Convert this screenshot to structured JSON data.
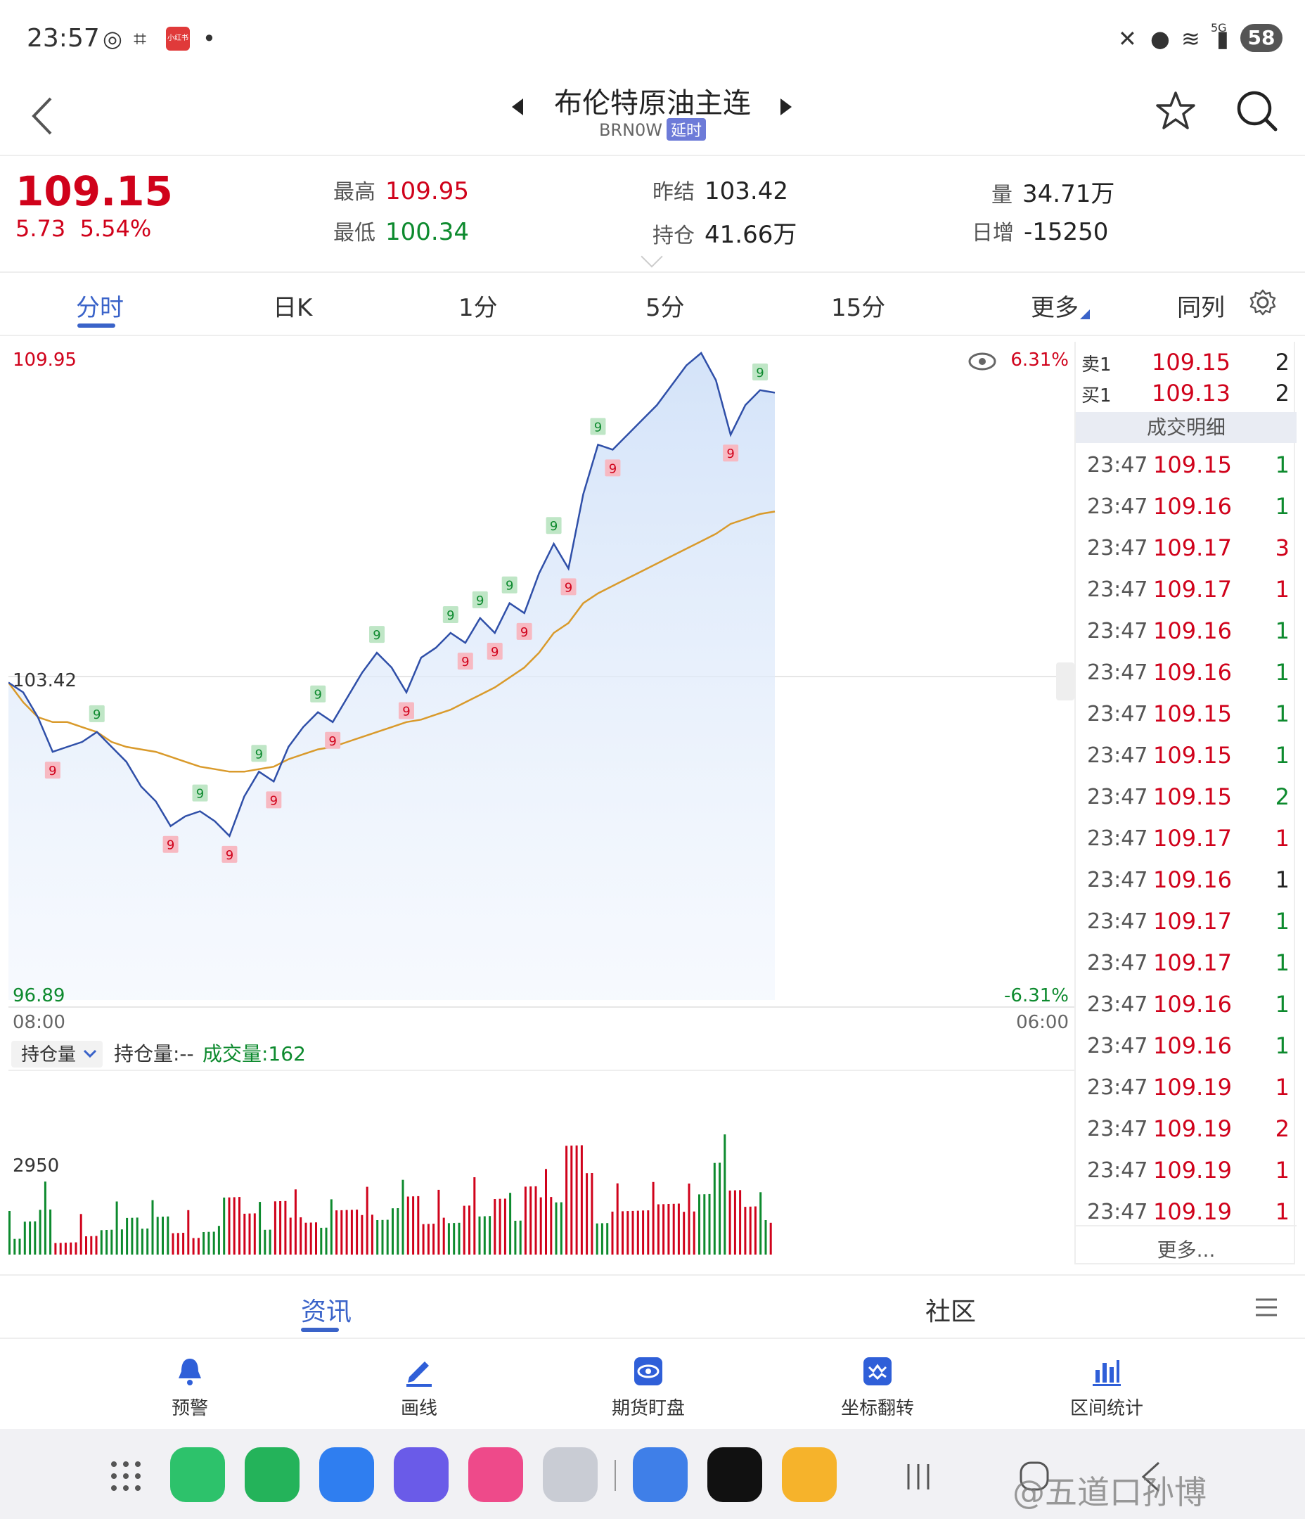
{
  "status_bar": {
    "time": "23:57",
    "badge_text": "小红书",
    "battery": "58",
    "network": "5G"
  },
  "header": {
    "title": "布伦特原油主连",
    "code": "BRN0W",
    "delay_badge": "延时"
  },
  "quote": {
    "last_price": "109.15",
    "change": "5.73",
    "change_pct": "5.54%",
    "high_label": "最高",
    "high": "109.95",
    "low_label": "最低",
    "low": "100.34",
    "prev_settle_label": "昨结",
    "prev_settle": "103.42",
    "open_interest_label": "持仓",
    "open_interest": "41.66万",
    "volume_label": "量",
    "volume": "34.71万",
    "daily_change_label": "日增",
    "daily_change": "-15250"
  },
  "tabs": [
    "分时",
    "日K",
    "1分",
    "5分",
    "15分",
    "更多",
    "同列"
  ],
  "chart": {
    "y_top": "109.95",
    "y_mid": "103.42",
    "y_bottom": "96.89",
    "pct_top": "6.31%",
    "pct_bottom": "-6.31%",
    "x_start": "08:00",
    "x_end": "06:00",
    "indicator_select": "持仓量",
    "oi_text": "持仓量:--",
    "vol_text": "成交量:162",
    "vol_axis_label": "2950"
  },
  "chart_data": {
    "type": "line",
    "ylim": [
      96.89,
      109.95
    ],
    "reference": 103.42,
    "signal_marker": "9",
    "series": [
      {
        "values": [
          103.3,
          103.1,
          102.6,
          101.9,
          102.0,
          102.1,
          102.3,
          102.0,
          101.7,
          101.2,
          100.9,
          100.4,
          100.6,
          100.7,
          100.5,
          100.2,
          101.0,
          101.5,
          101.3,
          102.0,
          102.4,
          102.7,
          102.5,
          103.0,
          103.5,
          103.9,
          103.6,
          103.1,
          103.8,
          104.0,
          104.3,
          104.1,
          104.6,
          104.3,
          104.9,
          104.7,
          105.5,
          106.1,
          105.6,
          107.1,
          108.1,
          108.0,
          108.3,
          108.6,
          108.9,
          109.3,
          109.7,
          109.95,
          109.4,
          108.3,
          108.9,
          109.2,
          109.15
        ]
      },
      {
        "values": [
          103.3,
          102.9,
          102.6,
          102.5,
          102.5,
          102.4,
          102.3,
          102.1,
          102.0,
          101.95,
          101.9,
          101.8,
          101.7,
          101.6,
          101.55,
          101.5,
          101.5,
          101.55,
          101.6,
          101.75,
          101.85,
          101.95,
          102.0,
          102.1,
          102.2,
          102.3,
          102.4,
          102.5,
          102.55,
          102.65,
          102.75,
          102.9,
          103.05,
          103.2,
          103.4,
          103.6,
          103.9,
          104.3,
          104.5,
          104.9,
          105.1,
          105.25,
          105.4,
          105.55,
          105.7,
          105.85,
          106.0,
          106.15,
          106.3,
          106.5,
          106.6,
          106.7,
          106.75
        ]
      }
    ],
    "volume_ylim": [
      0,
      2950
    ]
  },
  "order_book": {
    "ask_label": "卖1",
    "ask_price": "109.15",
    "ask_qty": "2",
    "bid_label": "买1",
    "bid_price": "109.13",
    "bid_qty": "2",
    "detail_header": "成交明细",
    "trades": [
      {
        "time": "23:47",
        "price": "109.15",
        "qty": "1",
        "dir": "buy"
      },
      {
        "time": "23:47",
        "price": "109.16",
        "qty": "1",
        "dir": "buy"
      },
      {
        "time": "23:47",
        "price": "109.17",
        "qty": "3",
        "dir": "sell"
      },
      {
        "time": "23:47",
        "price": "109.17",
        "qty": "1",
        "dir": "sell"
      },
      {
        "time": "23:47",
        "price": "109.16",
        "qty": "1",
        "dir": "buy"
      },
      {
        "time": "23:47",
        "price": "109.16",
        "qty": "1",
        "dir": "buy"
      },
      {
        "time": "23:47",
        "price": "109.15",
        "qty": "1",
        "dir": "buy"
      },
      {
        "time": "23:47",
        "price": "109.15",
        "qty": "1",
        "dir": "buy"
      },
      {
        "time": "23:47",
        "price": "109.15",
        "qty": "2",
        "dir": "buy"
      },
      {
        "time": "23:47",
        "price": "109.17",
        "qty": "1",
        "dir": "sell"
      },
      {
        "time": "23:47",
        "price": "109.16",
        "qty": "1",
        "dir": "neutral"
      },
      {
        "time": "23:47",
        "price": "109.17",
        "qty": "1",
        "dir": "buy"
      },
      {
        "time": "23:47",
        "price": "109.17",
        "qty": "1",
        "dir": "buy"
      },
      {
        "time": "23:47",
        "price": "109.16",
        "qty": "1",
        "dir": "buy"
      },
      {
        "time": "23:47",
        "price": "109.16",
        "qty": "1",
        "dir": "buy"
      },
      {
        "time": "23:47",
        "price": "109.19",
        "qty": "1",
        "dir": "sell"
      },
      {
        "time": "23:47",
        "price": "109.19",
        "qty": "2",
        "dir": "sell"
      },
      {
        "time": "23:47",
        "price": "109.19",
        "qty": "1",
        "dir": "sell"
      },
      {
        "time": "23:47",
        "price": "109.19",
        "qty": "1",
        "dir": "sell"
      }
    ],
    "more": "更多..."
  },
  "sections": {
    "news": "资讯",
    "community": "社区"
  },
  "tools": [
    "预警",
    "画线",
    "期货盯盘",
    "坐标翻转",
    "区间统计"
  ],
  "watermark": "@五道口孙博",
  "colors": {
    "up": "#d0021b",
    "down": "#0d8a2e",
    "accent": "#3a63c9",
    "price_line": "#2f4fa8",
    "avg_line": "#d99a2b"
  }
}
